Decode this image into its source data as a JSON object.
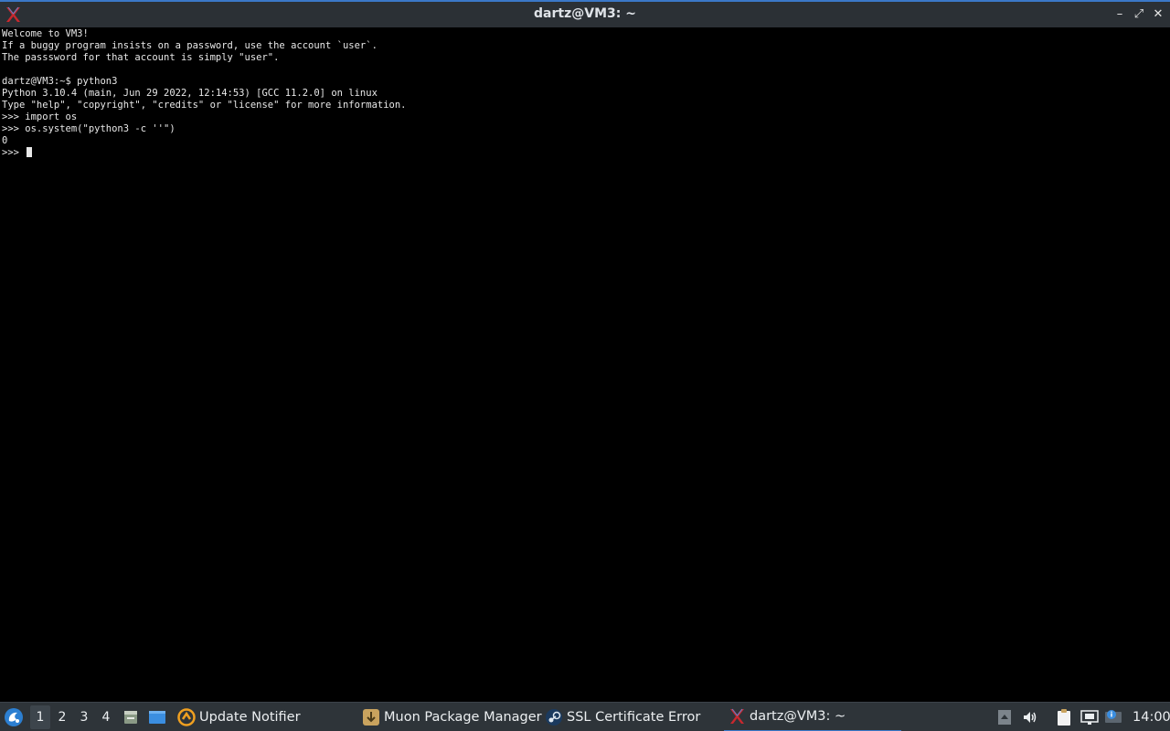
{
  "window": {
    "title": "dartz@VM3: ~",
    "minimize_glyph": "–",
    "maximize_glyph": "⤢",
    "close_glyph": "✕"
  },
  "terminal": {
    "lines": [
      "Welcome to VM3!",
      "If a buggy program insists on a password, use the account `user`.",
      "The passsword for that account is simply \"user\".",
      "",
      "dartz@VM3:~$ python3",
      "Python 3.10.4 (main, Jun 29 2022, 12:14:53) [GCC 11.2.0] on linux",
      "Type \"help\", \"copyright\", \"credits\" or \"license\" for more information.",
      ">>> import os",
      ">>> os.system(\"python3 -c ''\")",
      "0"
    ],
    "prompt": ">>> "
  },
  "taskbar": {
    "desktops": [
      "1",
      "2",
      "3",
      "4"
    ],
    "active_desktop": "1",
    "tasks": [
      {
        "label": "Update Notifier",
        "icon": "update-notifier-icon"
      },
      {
        "label": "Muon Package Manager",
        "icon": "muon-package-icon"
      },
      {
        "label": "SSL Certificate Error",
        "icon": "steam-icon"
      },
      {
        "label": "dartz@VM3: ~",
        "icon": "terminal-x-icon"
      }
    ],
    "clock": "14:00"
  },
  "colors": {
    "accent": "#3b78c8",
    "titlebar": "#2b3035",
    "taskbar": "#2e3439",
    "terminal_bg": "#000000",
    "terminal_fg": "#e8e8e8"
  }
}
